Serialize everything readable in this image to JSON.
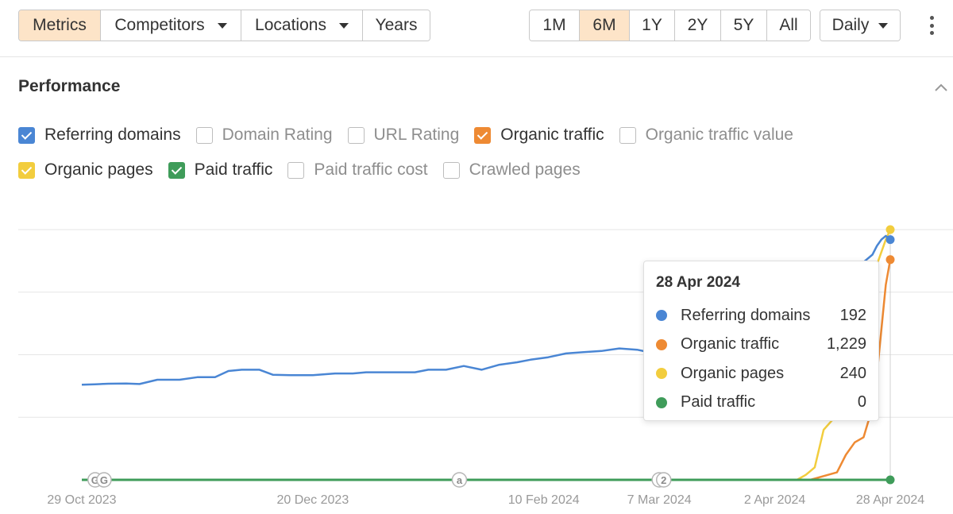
{
  "toolbar": {
    "left_buttons": [
      {
        "label": "Metrics",
        "active": true,
        "dropdown": false
      },
      {
        "label": "Competitors",
        "active": false,
        "dropdown": true
      },
      {
        "label": "Locations",
        "active": false,
        "dropdown": true
      },
      {
        "label": "Years",
        "active": false,
        "dropdown": false
      }
    ],
    "ranges": [
      {
        "label": "1M",
        "active": false
      },
      {
        "label": "6M",
        "active": true
      },
      {
        "label": "1Y",
        "active": false
      },
      {
        "label": "2Y",
        "active": false
      },
      {
        "label": "5Y",
        "active": false
      },
      {
        "label": "All",
        "active": false
      }
    ],
    "interval_label": "Daily",
    "active_color": "#fde4c8"
  },
  "section": {
    "title": "Performance"
  },
  "metrics": {
    "row1": [
      {
        "label": "Referring domains",
        "checked": true,
        "color": "#4a86d4"
      },
      {
        "label": "Domain Rating",
        "checked": false,
        "color": ""
      },
      {
        "label": "URL Rating",
        "checked": false,
        "color": ""
      },
      {
        "label": "Organic traffic",
        "checked": true,
        "color": "#ee8a33"
      },
      {
        "label": "Organic traffic value",
        "checked": false,
        "color": ""
      }
    ],
    "row2": [
      {
        "label": "Organic pages",
        "checked": true,
        "color": "#f2cd3e"
      },
      {
        "label": "Paid traffic",
        "checked": true,
        "color": "#3f9c5a"
      },
      {
        "label": "Paid traffic cost",
        "checked": false,
        "color": ""
      },
      {
        "label": "Crawled pages",
        "checked": false,
        "color": ""
      }
    ]
  },
  "tooltip": {
    "date": "28 Apr 2024",
    "rows": [
      {
        "name": "Referring domains",
        "value": "192",
        "color": "#4a86d4"
      },
      {
        "name": "Organic traffic",
        "value": "1,229",
        "color": "#ee8a33"
      },
      {
        "name": "Organic pages",
        "value": "240",
        "color": "#f2cd3e"
      },
      {
        "name": "Paid traffic",
        "value": "0",
        "color": "#3f9c5a"
      }
    ]
  },
  "chart_data": {
    "type": "line",
    "x_start": "2023-10-29",
    "x_end": "2024-04-28",
    "x_ticks": [
      {
        "label": "29 Oct 2023",
        "date": "2023-10-29"
      },
      {
        "label": "20 Dec 2023",
        "date": "2023-12-20"
      },
      {
        "label": "10 Feb 2024",
        "date": "2024-02-10"
      },
      {
        "label": "7 Mar 2024",
        "date": "2024-03-07"
      },
      {
        "label": "2 Apr 2024",
        "date": "2024-04-02"
      },
      {
        "label": "28 Apr 2024",
        "date": "2024-04-28"
      }
    ],
    "y_gridlines": 5,
    "grid": true,
    "annotations": [
      {
        "label": "G",
        "date": "2023-11-01"
      },
      {
        "label": "G",
        "date": "2023-11-03"
      },
      {
        "label": "a",
        "date": "2024-01-22"
      },
      {
        "label": "",
        "date": "2024-03-07"
      },
      {
        "label": "2",
        "date": "2024-03-08"
      }
    ],
    "hover_date": "2024-04-28",
    "series": [
      {
        "name": "Referring domains",
        "color": "#4a86d4",
        "points": [
          [
            "2023-10-29",
            0.38
          ],
          [
            "2023-11-01",
            0.382
          ],
          [
            "2023-11-04",
            0.384
          ],
          [
            "2023-11-08",
            0.385
          ],
          [
            "2023-11-11",
            0.383
          ],
          [
            "2023-11-15",
            0.4
          ],
          [
            "2023-11-20",
            0.4
          ],
          [
            "2023-11-24",
            0.41
          ],
          [
            "2023-11-28",
            0.41
          ],
          [
            "2023-12-01",
            0.435
          ],
          [
            "2023-12-04",
            0.44
          ],
          [
            "2023-12-08",
            0.44
          ],
          [
            "2023-12-11",
            0.42
          ],
          [
            "2023-12-15",
            0.418
          ],
          [
            "2023-12-20",
            0.418
          ],
          [
            "2023-12-25",
            0.425
          ],
          [
            "2023-12-29",
            0.425
          ],
          [
            "2024-01-01",
            0.43
          ],
          [
            "2024-01-05",
            0.43
          ],
          [
            "2024-01-09",
            0.43
          ],
          [
            "2024-01-12",
            0.43
          ],
          [
            "2024-01-15",
            0.44
          ],
          [
            "2024-01-19",
            0.44
          ],
          [
            "2024-01-23",
            0.455
          ],
          [
            "2024-01-27",
            0.44
          ],
          [
            "2024-01-31",
            0.46
          ],
          [
            "2024-02-04",
            0.47
          ],
          [
            "2024-02-07",
            0.48
          ],
          [
            "2024-02-11",
            0.49
          ],
          [
            "2024-02-15",
            0.505
          ],
          [
            "2024-02-19",
            0.51
          ],
          [
            "2024-02-23",
            0.515
          ],
          [
            "2024-02-27",
            0.525
          ],
          [
            "2024-03-02",
            0.52
          ],
          [
            "2024-03-06",
            0.505
          ],
          [
            "2024-03-10",
            0.51
          ],
          [
            "2024-03-14",
            0.505
          ],
          [
            "2024-03-18",
            0.5
          ],
          [
            "2024-03-22",
            0.49
          ],
          [
            "2024-03-26",
            0.48
          ],
          [
            "2024-03-30",
            0.48
          ],
          [
            "2024-04-03",
            0.48
          ],
          [
            "2024-04-07",
            0.48
          ],
          [
            "2024-04-10",
            0.49
          ],
          [
            "2024-04-13",
            0.55
          ],
          [
            "2024-04-16",
            0.64
          ],
          [
            "2024-04-19",
            0.78
          ],
          [
            "2024-04-22",
            0.87
          ],
          [
            "2024-04-24",
            0.9
          ],
          [
            "2024-04-25",
            0.935
          ],
          [
            "2024-04-26",
            0.96
          ],
          [
            "2024-04-27",
            0.975
          ],
          [
            "2024-04-28",
            0.96
          ]
        ]
      },
      {
        "name": "Organic traffic",
        "color": "#ee8a33",
        "points": [
          [
            "2023-10-29",
            0
          ],
          [
            "2024-04-07",
            0
          ],
          [
            "2024-04-10",
            0
          ],
          [
            "2024-04-14",
            0.02
          ],
          [
            "2024-04-16",
            0.03
          ],
          [
            "2024-04-18",
            0.1
          ],
          [
            "2024-04-20",
            0.15
          ],
          [
            "2024-04-22",
            0.17
          ],
          [
            "2024-04-23",
            0.23
          ],
          [
            "2024-04-24",
            0.28
          ],
          [
            "2024-04-25",
            0.42
          ],
          [
            "2024-04-26",
            0.6
          ],
          [
            "2024-04-27",
            0.78
          ],
          [
            "2024-04-28",
            0.88
          ]
        ]
      },
      {
        "name": "Organic pages",
        "color": "#f2cd3e",
        "points": [
          [
            "2023-10-29",
            0
          ],
          [
            "2024-04-07",
            0
          ],
          [
            "2024-04-09",
            0.02
          ],
          [
            "2024-04-11",
            0.05
          ],
          [
            "2024-04-13",
            0.2
          ],
          [
            "2024-04-15",
            0.24
          ],
          [
            "2024-04-17",
            0.38
          ],
          [
            "2024-04-19",
            0.5
          ],
          [
            "2024-04-21",
            0.62
          ],
          [
            "2024-04-23",
            0.72
          ],
          [
            "2024-04-25",
            0.86
          ],
          [
            "2024-04-27",
            0.96
          ],
          [
            "2024-04-28",
            1.0
          ]
        ]
      },
      {
        "name": "Paid traffic",
        "color": "#3f9c5a",
        "points": [
          [
            "2023-10-29",
            0
          ],
          [
            "2024-04-28",
            0
          ]
        ]
      }
    ]
  }
}
